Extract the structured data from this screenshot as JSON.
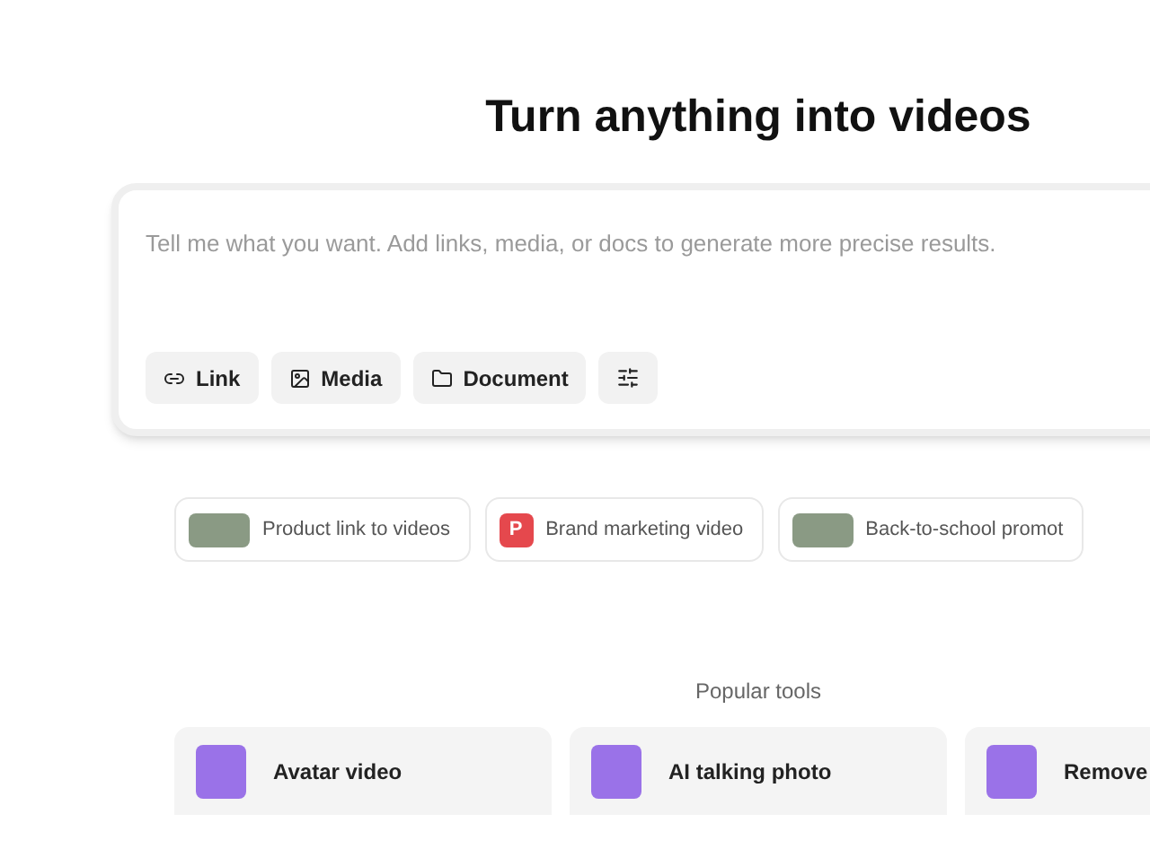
{
  "heading": "Turn anything into videos",
  "prompt": {
    "placeholder": "Tell me what you want. Add links, media, or docs to generate more precise results.",
    "buttons": [
      {
        "kind": "link",
        "label": "Link"
      },
      {
        "kind": "media",
        "label": "Media"
      },
      {
        "kind": "document",
        "label": "Document"
      },
      {
        "kind": "settings"
      }
    ]
  },
  "suggestions": [
    {
      "kind": "photo",
      "label": "Product link to videos"
    },
    {
      "kind": "letter",
      "letter": "P",
      "label": "Brand marketing video"
    },
    {
      "kind": "photo",
      "label": "Back-to-school promot"
    }
  ],
  "popular_tools": {
    "title": "Popular tools",
    "items": [
      {
        "label": "Avatar video"
      },
      {
        "label": "AI talking photo"
      },
      {
        "label": "Remove"
      }
    ]
  }
}
